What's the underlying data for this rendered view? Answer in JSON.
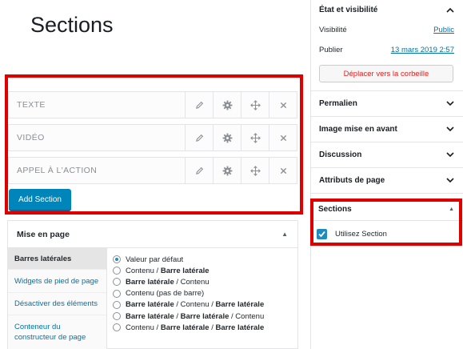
{
  "page": {
    "title": "Sections"
  },
  "sections_builder": {
    "rows": [
      {
        "label": "TEXTE"
      },
      {
        "label": "VIDÉO"
      },
      {
        "label": "APPEL À L'ACTION"
      }
    ],
    "row_actions": [
      "pencil-icon",
      "gear-icon",
      "move-icon",
      "close-icon"
    ],
    "add_button_label": "Add Section",
    "accent_color": "#0085ba",
    "highlight_color": "#e00000"
  },
  "layout_panel": {
    "title": "Mise en page",
    "tabs": [
      {
        "label": "Barres latérales",
        "active": true
      },
      {
        "label": "Widgets de pied de page",
        "active": false
      },
      {
        "label": "Désactiver des éléments",
        "active": false
      },
      {
        "label": "Conteneur du constructeur de page",
        "active": false
      }
    ],
    "options": [
      {
        "parts": [
          {
            "t": "Valeur par défaut",
            "b": false
          }
        ],
        "checked": true
      },
      {
        "parts": [
          {
            "t": "Contenu",
            "b": false
          },
          {
            "t": " / ",
            "b": false
          },
          {
            "t": "Barre latérale",
            "b": true
          }
        ],
        "checked": false
      },
      {
        "parts": [
          {
            "t": "Barre latérale",
            "b": true
          },
          {
            "t": " / Contenu",
            "b": false
          }
        ],
        "checked": false
      },
      {
        "parts": [
          {
            "t": "Contenu (pas de barre)",
            "b": false
          }
        ],
        "checked": false
      },
      {
        "parts": [
          {
            "t": "Barre latérale",
            "b": true
          },
          {
            "t": " / Contenu / ",
            "b": false
          },
          {
            "t": "Barre latérale",
            "b": true
          }
        ],
        "checked": false
      },
      {
        "parts": [
          {
            "t": "Barre latérale",
            "b": true
          },
          {
            "t": " / ",
            "b": false
          },
          {
            "t": "Barre latérale",
            "b": true
          },
          {
            "t": " / Contenu",
            "b": false
          }
        ],
        "checked": false
      },
      {
        "parts": [
          {
            "t": "Contenu / ",
            "b": false
          },
          {
            "t": "Barre latérale",
            "b": true
          },
          {
            "t": " / ",
            "b": false
          },
          {
            "t": "Barre latérale",
            "b": true
          }
        ],
        "checked": false
      }
    ]
  },
  "sidebar": {
    "status": {
      "title": "État et visibilité",
      "visibility_label": "Visibilité",
      "visibility_value": "Public",
      "publish_label": "Publier",
      "publish_value": "13 mars 2019 2:57",
      "trash_label": "Déplacer vers la corbeille"
    },
    "panels": [
      {
        "title": "Permalien"
      },
      {
        "title": "Image mise en avant"
      },
      {
        "title": "Discussion"
      },
      {
        "title": "Attributs de page"
      }
    ],
    "sections_panel": {
      "title": "Sections",
      "checkbox_label": "Utilisez Section",
      "checked": true
    }
  }
}
